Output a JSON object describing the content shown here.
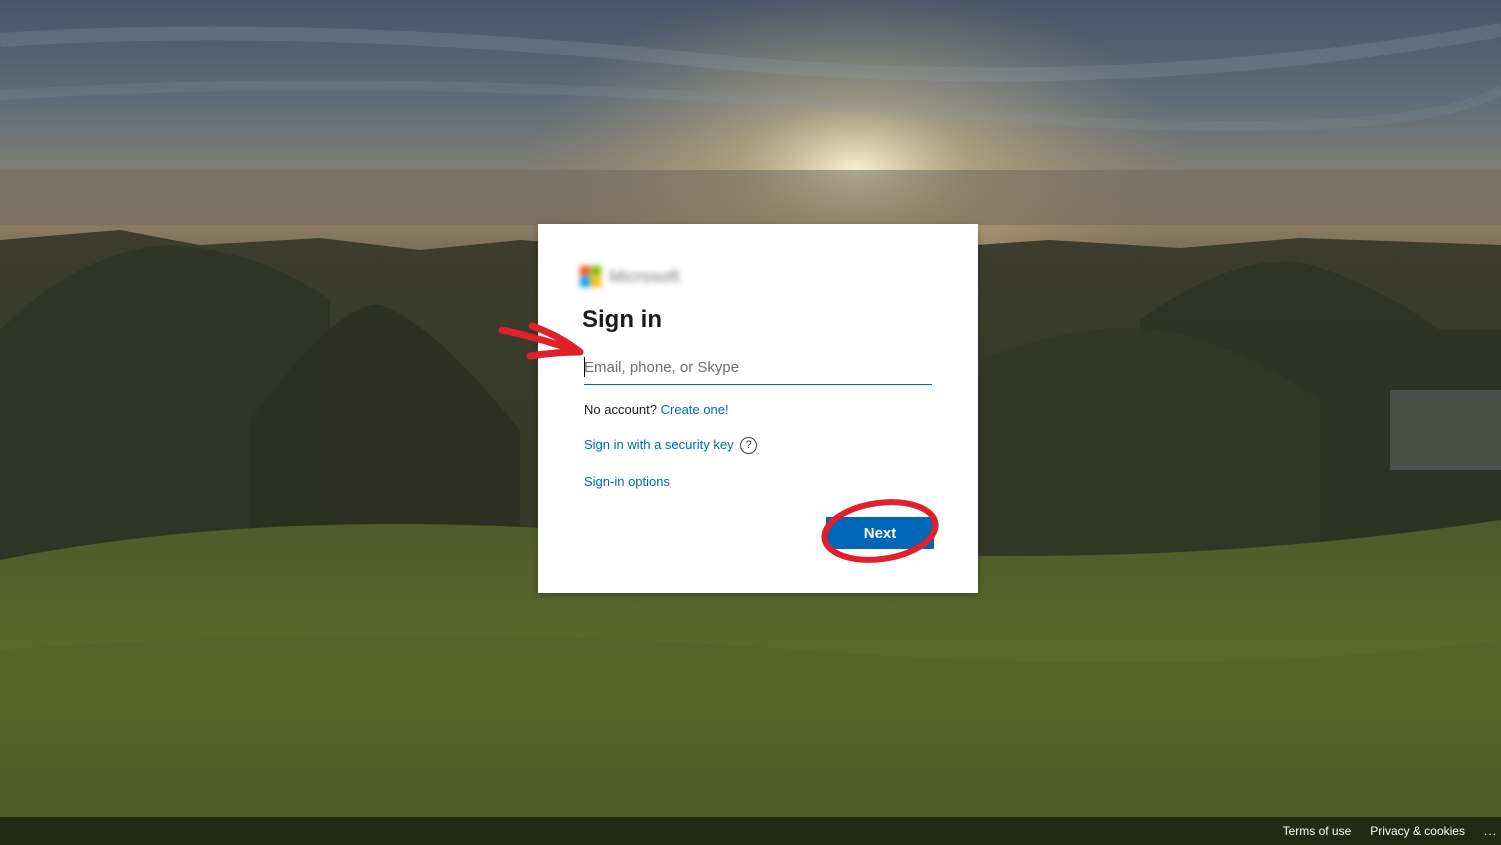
{
  "brand": {
    "logo_text": "Microsoft",
    "logo_colors": [
      "#f25022",
      "#7fba00",
      "#00a4ef",
      "#ffb900"
    ]
  },
  "signin": {
    "title": "Sign in",
    "email_placeholder": "Email, phone, or Skype",
    "email_value": "",
    "no_account_text": "No account?",
    "create_link": "Create one!",
    "security_key_link": "Sign in with a security key",
    "help_icon_glyph": "?",
    "options_link": "Sign-in options",
    "next_button": "Next"
  },
  "footer": {
    "terms": "Terms of use",
    "privacy": "Privacy & cookies",
    "more": "..."
  },
  "colors": {
    "accent": "#0067b8",
    "annotation": "#e0202a"
  }
}
